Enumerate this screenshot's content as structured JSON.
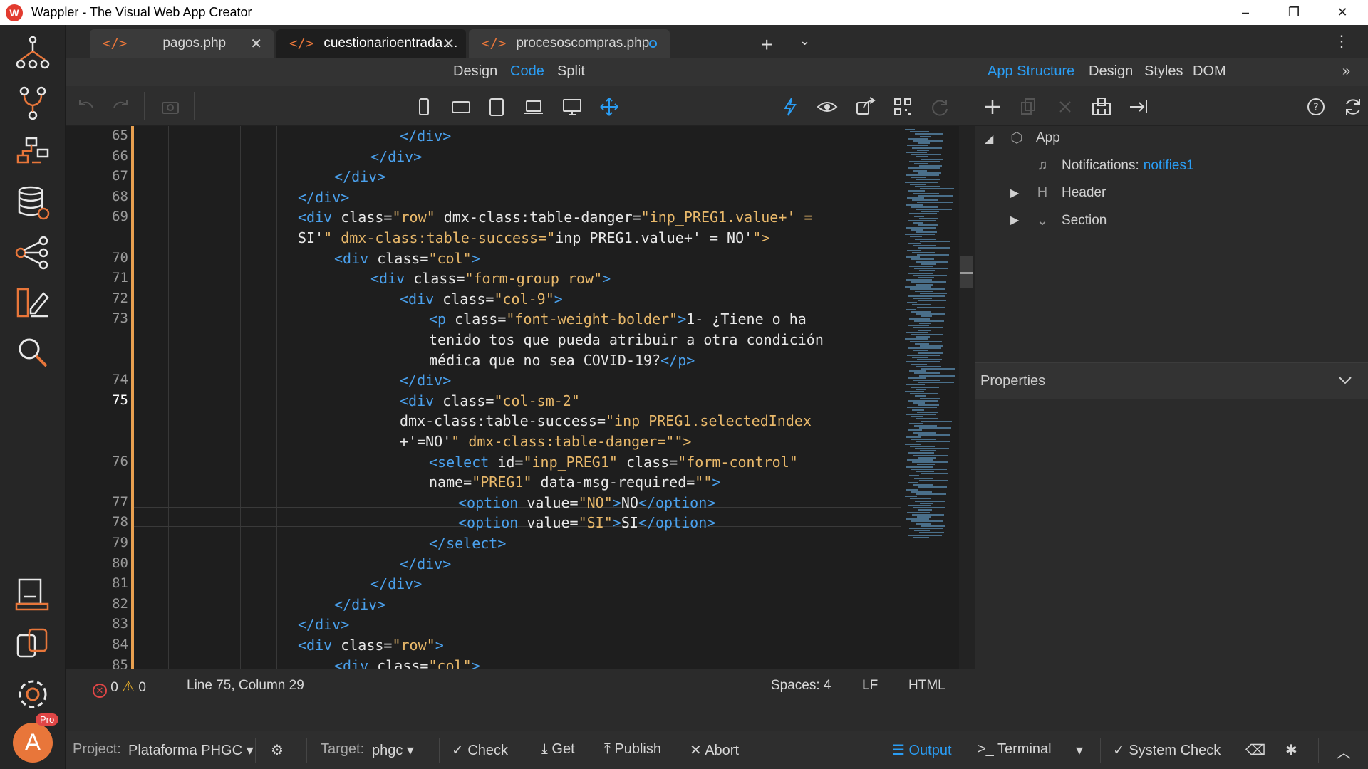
{
  "window": {
    "title": "Wappler - The Visual Web App Creator",
    "minimize": "–",
    "maximize": "❐",
    "close": "✕"
  },
  "tabs": [
    {
      "label": "pagos.php",
      "close": "✕",
      "icon": "code-file-icon"
    },
    {
      "label": "cuestionarioentrada....",
      "close": "✕",
      "icon": "code-file-icon"
    },
    {
      "label": "procesoscompras.php",
      "icon": "code-file-icon"
    }
  ],
  "tabbar": {
    "add": "+",
    "dropdown": "⌄",
    "menu": "⋮"
  },
  "views": {
    "design": "Design",
    "code": "Code",
    "split": "Split",
    "active": "Code"
  },
  "right_header": {
    "app_structure": "App Structure",
    "design": "Design",
    "styles": "Styles",
    "dom": "DOM",
    "expand": "»"
  },
  "code_lines": [
    {
      "n": "65",
      "row": 0,
      "indent": 8,
      "html": "</div>"
    },
    {
      "n": "66",
      "row": 1,
      "indent": 7,
      "html": "</div>"
    },
    {
      "n": "67",
      "row": 2,
      "indent": 6,
      "html": "</div>"
    },
    {
      "n": "68",
      "row": 3,
      "indent": 5,
      "html": "</div>"
    },
    {
      "n": "69",
      "row": 4,
      "indent": 5,
      "html": "<div class=\"row\" dmx-class:table-danger=\"inp_PREG1.value+' ="
    },
    {
      "n": "",
      "row": 5,
      "indent": 5,
      "html": "SI'\" dmx-class:table-success=\"inp_PREG1.value+' = NO'\">"
    },
    {
      "n": "70",
      "row": 6,
      "indent": 6,
      "html": "<div class=\"col\">"
    },
    {
      "n": "71",
      "row": 7,
      "indent": 7,
      "html": "<div class=\"form-group row\">"
    },
    {
      "n": "72",
      "row": 8,
      "indent": 8,
      "html": "<div class=\"col-9\">"
    },
    {
      "n": "73",
      "row": 9,
      "indent": 9,
      "html": "<p class=\"font-weight-bolder\">1- ¿Tiene o ha"
    },
    {
      "n": "",
      "row": 10,
      "indent": 9,
      "html": "tenido tos que pueda atribuir a otra condición"
    },
    {
      "n": "",
      "row": 11,
      "indent": 9,
      "html": "médica que no sea COVID-19?</p>"
    },
    {
      "n": "74",
      "row": 12,
      "indent": 8,
      "html": "</div>"
    },
    {
      "n": "75",
      "row": 13,
      "indent": 8,
      "html": "<div class=\"col-sm-2\""
    },
    {
      "n": "",
      "row": 14,
      "indent": 8,
      "html": "dmx-class:table-success=\"inp_PREG1.selectedIndex"
    },
    {
      "n": "",
      "row": 15,
      "indent": 8,
      "html": "+'=NO'\" dmx-class:table-danger=\"\">"
    },
    {
      "n": "76",
      "row": 16,
      "indent": 9,
      "html": "<select id=\"inp_PREG1\" class=\"form-control\""
    },
    {
      "n": "",
      "row": 17,
      "indent": 9,
      "html": "name=\"PREG1\" data-msg-required=\"\">"
    },
    {
      "n": "77",
      "row": 18,
      "indent": 10,
      "html": "<option value=\"NO\">NO</option>"
    },
    {
      "n": "78",
      "row": 19,
      "indent": 10,
      "html": "<option value=\"SI\">SI</option>"
    },
    {
      "n": "79",
      "row": 20,
      "indent": 9,
      "html": "</select>"
    },
    {
      "n": "80",
      "row": 21,
      "indent": 8,
      "html": "</div>"
    },
    {
      "n": "81",
      "row": 22,
      "indent": 7,
      "html": "</div>"
    },
    {
      "n": "82",
      "row": 23,
      "indent": 6,
      "html": "</div>"
    },
    {
      "n": "83",
      "row": 24,
      "indent": 5,
      "html": "</div>"
    },
    {
      "n": "84",
      "row": 25,
      "indent": 5,
      "html": "<div class=\"row\">"
    },
    {
      "n": "85",
      "row": 26,
      "indent": 6,
      "html": "<div class=\"col\">"
    }
  ],
  "current_line": "75",
  "status": {
    "errors": "0",
    "warnings": "0",
    "position": "Line 75, Column 29",
    "spaces": "Spaces: 4",
    "eol": "LF",
    "language": "HTML"
  },
  "tree": {
    "app": "App",
    "notifications_label": "Notifications:",
    "notifications_value": "notifies1",
    "header": "Header",
    "section": "Section"
  },
  "properties": {
    "title": "Properties"
  },
  "bottombar": {
    "project_label": "Project:",
    "project_value": "Plataforma PHGC",
    "target_label": "Target:",
    "target_value": "phgc",
    "check": "Check",
    "get": "Get",
    "publish": "Publish",
    "abort": "Abort",
    "output": "Output",
    "terminal": "Terminal",
    "system_check": "System Check"
  },
  "user": {
    "avatar_letter": "A",
    "badge": "Pro"
  },
  "colors": {
    "accent": "#2a9df4",
    "tag": "#4aa0ec",
    "string": "#e8b86a",
    "brand": "#e23b2f",
    "gutter_mark": "#e8a050"
  }
}
